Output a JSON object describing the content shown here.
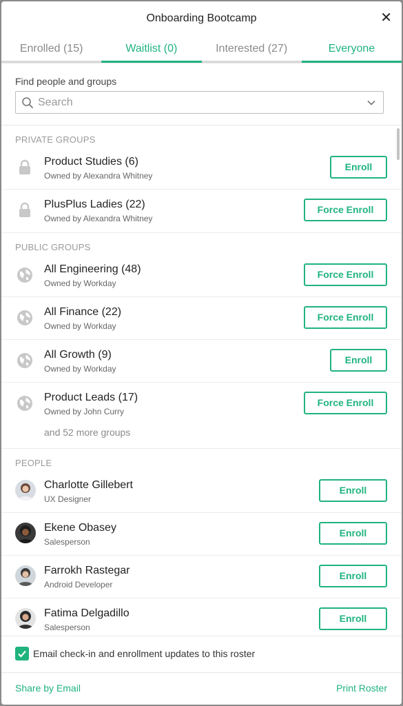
{
  "header": {
    "title": "Onboarding Bootcamp",
    "close_label": "✕"
  },
  "tabs": [
    {
      "label": "Enrolled (15)"
    },
    {
      "label": "Waitlist (0)"
    },
    {
      "label": "Interested (27)"
    },
    {
      "label": "Everyone"
    }
  ],
  "find": {
    "label": "Find people and groups",
    "placeholder": "Search"
  },
  "private_groups": {
    "label": "PRIVATE GROUPS",
    "items": [
      {
        "name": "Product Studies (6)",
        "owner": "Owned by Alexandra Whitney",
        "action": "Enroll"
      },
      {
        "name": "PlusPlus Ladies (22)",
        "owner": "Owned by Alexandra Whitney",
        "action": "Force Enroll"
      }
    ]
  },
  "public_groups": {
    "label": "PUBLIC GROUPS",
    "items": [
      {
        "name": "All Engineering (48)",
        "owner": "Owned by Workday",
        "action": "Force Enroll"
      },
      {
        "name": "All Finance (22)",
        "owner": "Owned by Workday",
        "action": "Force Enroll"
      },
      {
        "name": "All Growth (9)",
        "owner": "Owned by Workday",
        "action": "Enroll"
      },
      {
        "name": "Product Leads (17)",
        "owner": "Owned by John Curry",
        "action": "Force Enroll"
      }
    ],
    "more": "and 52 more groups"
  },
  "people": {
    "label": "PEOPLE",
    "items": [
      {
        "name": "Charlotte Gillebert",
        "role": "UX Designer",
        "action": "Enroll"
      },
      {
        "name": "Ekene Obasey",
        "role": "Salesperson",
        "action": "Enroll"
      },
      {
        "name": "Farrokh Rastegar",
        "role": "Android Developer",
        "action": "Enroll"
      },
      {
        "name": "Fatima Delgadillo",
        "role": "Salesperson",
        "action": "Enroll"
      }
    ]
  },
  "email_updates": {
    "label": "Email check-in and enrollment updates to this roster",
    "checked": true
  },
  "footer": {
    "share": "Share by Email",
    "print": "Print Roster"
  },
  "colors": {
    "accent": "#1fb37e",
    "muted": "#9a9a9a"
  }
}
